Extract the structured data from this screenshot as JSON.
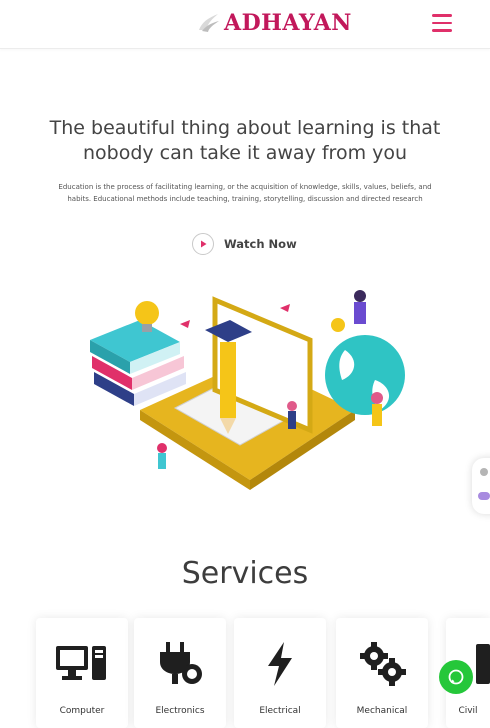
{
  "header": {
    "logo_text": "ADHAYAN",
    "menu_icon": "hamburger-menu-icon"
  },
  "hero": {
    "title": "The beautiful thing about learning is that nobody can take it away from you",
    "description": "Education is the process of facilitating learning, or the acquisition of knowledge, skills, values, beliefs, and habits. Educational methods include teaching, training, storytelling, discussion and directed research",
    "watch_label": "Watch Now",
    "watch_icon": "play-circle-icon"
  },
  "services": {
    "title": "Services",
    "items": [
      {
        "label": "Computer",
        "icon": "computer-icon"
      },
      {
        "label": "Electronics",
        "icon": "plug-icon"
      },
      {
        "label": "Electrical",
        "icon": "lightning-icon"
      },
      {
        "label": "Mechanical",
        "icon": "gears-icon"
      },
      {
        "label": "Civil",
        "icon": "building-icon"
      }
    ]
  },
  "chat": {
    "icon": "chat-icon"
  },
  "colors": {
    "brand": "#c2185b",
    "menu": "#e0306a",
    "icon_dark": "#1f1f1f",
    "chat_green": "#25c73a"
  }
}
